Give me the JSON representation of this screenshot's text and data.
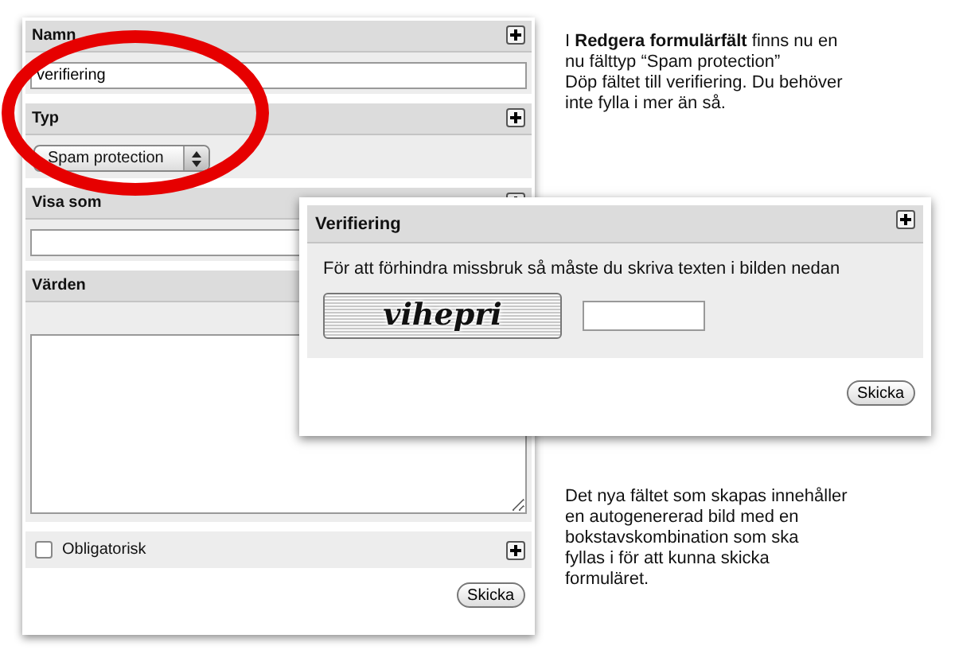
{
  "form": {
    "sections": [
      {
        "kind": "text",
        "label": "Namn",
        "plus": true,
        "value": "verifiering"
      },
      {
        "kind": "select",
        "label": "Typ",
        "plus": true,
        "value": "Spam protection"
      },
      {
        "kind": "text",
        "label": "Visa som",
        "plus": true
      },
      {
        "kind": "textarea",
        "label": "Värden"
      },
      {
        "kind": "checkbox",
        "label": "Obligatorisk",
        "plus": true,
        "checked": false
      }
    ],
    "submit": "Skicka"
  },
  "popup": {
    "title": "Verifiering",
    "text": "För att förhindra missbruk så måste du skriva texten i bilden nedan",
    "captcha": "vihepri",
    "submit": "Skicka"
  },
  "notes": [
    "I **Redgera formulärfält** finns nu en\nnu fälttyp “Spam protection”\nDöp fältet till verifiering. Du behöver\ninte fylla i mer än så.",
    "Det nya fältet som skapas innehåller\nen autogenererad bild med en\nbokstavskombination som ska\nfyllas i för att kunna skicka\nformuläret."
  ]
}
